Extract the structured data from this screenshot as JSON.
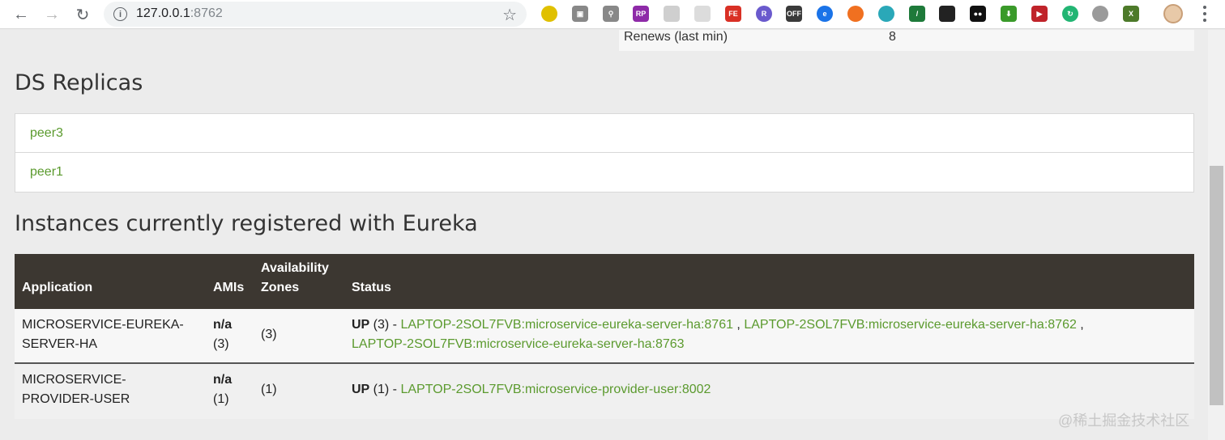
{
  "browser": {
    "url_host": "127.0.0.1",
    "url_port": ":8762",
    "extensions": [
      {
        "name": "ext-1",
        "color": "#e0c000",
        "text": "",
        "round": true
      },
      {
        "name": "ext-2",
        "color": "#888888",
        "text": "▣",
        "round": false
      },
      {
        "name": "ext-3",
        "color": "#888888",
        "text": "⚲",
        "round": false
      },
      {
        "name": "ext-rp",
        "color": "#8e2aa8",
        "text": "RP",
        "round": false
      },
      {
        "name": "ext-5",
        "color": "#cfcfcf",
        "text": "",
        "round": false
      },
      {
        "name": "ext-6",
        "color": "#dcdcdc",
        "text": "",
        "round": false
      },
      {
        "name": "ext-fe",
        "color": "#d93025",
        "text": "FE",
        "round": false
      },
      {
        "name": "ext-r",
        "color": "#6a5acd",
        "text": "R",
        "round": true
      },
      {
        "name": "ext-off",
        "color": "#3a3a3a",
        "text": "OFF",
        "round": false
      },
      {
        "name": "ext-e",
        "color": "#1a73e8",
        "text": "e",
        "round": true
      },
      {
        "name": "ext-11",
        "color": "#f07020",
        "text": "",
        "round": true
      },
      {
        "name": "ext-12",
        "color": "#2aa8b8",
        "text": "",
        "round": true
      },
      {
        "name": "ext-slash",
        "color": "#1e7a3a",
        "text": "/",
        "round": false
      },
      {
        "name": "ext-14",
        "color": "#222222",
        "text": "",
        "round": false
      },
      {
        "name": "ext-15",
        "color": "#111111",
        "text": "●●",
        "round": false
      },
      {
        "name": "ext-down",
        "color": "#3a9a2a",
        "text": "⬇",
        "round": false
      },
      {
        "name": "ext-play",
        "color": "#c0232a",
        "text": "▶",
        "round": false
      },
      {
        "name": "ext-18",
        "color": "#22b573",
        "text": "↻",
        "round": true
      },
      {
        "name": "ext-19",
        "color": "#9a9a9a",
        "text": "",
        "round": true
      },
      {
        "name": "ext-x",
        "color": "#4d7a2a",
        "text": "X",
        "round": false
      }
    ]
  },
  "general_info": {
    "renews_label": "Renews (last min)",
    "renews_value": "8"
  },
  "replicas": {
    "title": "DS Replicas",
    "items": [
      {
        "label": "peer3"
      },
      {
        "label": "peer1"
      }
    ]
  },
  "instances": {
    "title": "Instances currently registered with Eureka",
    "headers": {
      "application": "Application",
      "amis": "AMIs",
      "zones_line1": "Availability",
      "zones_line2": "Zones",
      "status": "Status"
    },
    "rows": [
      {
        "app_line1": "MICROSERVICE-EUREKA-",
        "app_line2": "SERVER-HA",
        "amis_line1": "n/a",
        "amis_line2": "(3)",
        "zones": "(3)",
        "status_up": "UP",
        "status_count": " (3) - ",
        "links": [
          "LAPTOP-2SOL7FVB:microservice-eureka-server-ha:8761",
          "LAPTOP-2SOL7FVB:microservice-eureka-server-ha:8762",
          "LAPTOP-2SOL7FVB:microservice-eureka-server-ha:8763"
        ],
        "sep": " , "
      },
      {
        "app_line1": "MICROSERVICE-",
        "app_line2": "PROVIDER-USER",
        "amis_line1": "n/a",
        "amis_line2": "(1)",
        "zones": "(1)",
        "status_up": "UP",
        "status_count": " (1) - ",
        "links": [
          "LAPTOP-2SOL7FVB:microservice-provider-user:8002"
        ]
      }
    ]
  },
  "watermark": "@稀土掘金技术社区"
}
